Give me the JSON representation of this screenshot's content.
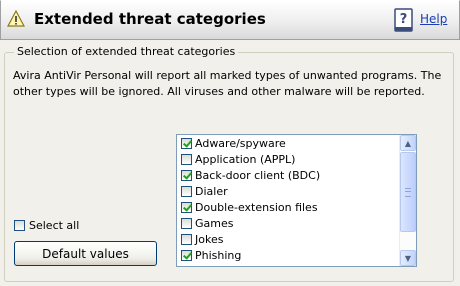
{
  "header": {
    "title": "Extended threat categories",
    "help_label": "Help",
    "warning_icon": "warning-triangle-icon",
    "help_icon": "help-book-icon"
  },
  "group": {
    "legend": "Selection of extended threat categories",
    "description": "Avira AntiVir Personal will report all marked types of unwanted programs. The other types will be ignored. All viruses and other malware will be reported."
  },
  "select_all": {
    "label": "Select all",
    "checked": false
  },
  "default_button": {
    "label": "Default values"
  },
  "categories": [
    {
      "label": "Adware/spyware",
      "checked": true
    },
    {
      "label": "Application (APPL)",
      "checked": false
    },
    {
      "label": "Back-door client (BDC)",
      "checked": true
    },
    {
      "label": "Dialer",
      "checked": false
    },
    {
      "label": "Double-extension files",
      "checked": true
    },
    {
      "label": "Games",
      "checked": false
    },
    {
      "label": "Jokes",
      "checked": false
    },
    {
      "label": "Phishing",
      "checked": true
    }
  ],
  "colors": {
    "accent": "#1a3fb4",
    "check": "#21a121",
    "background": "#f1f0ea"
  }
}
